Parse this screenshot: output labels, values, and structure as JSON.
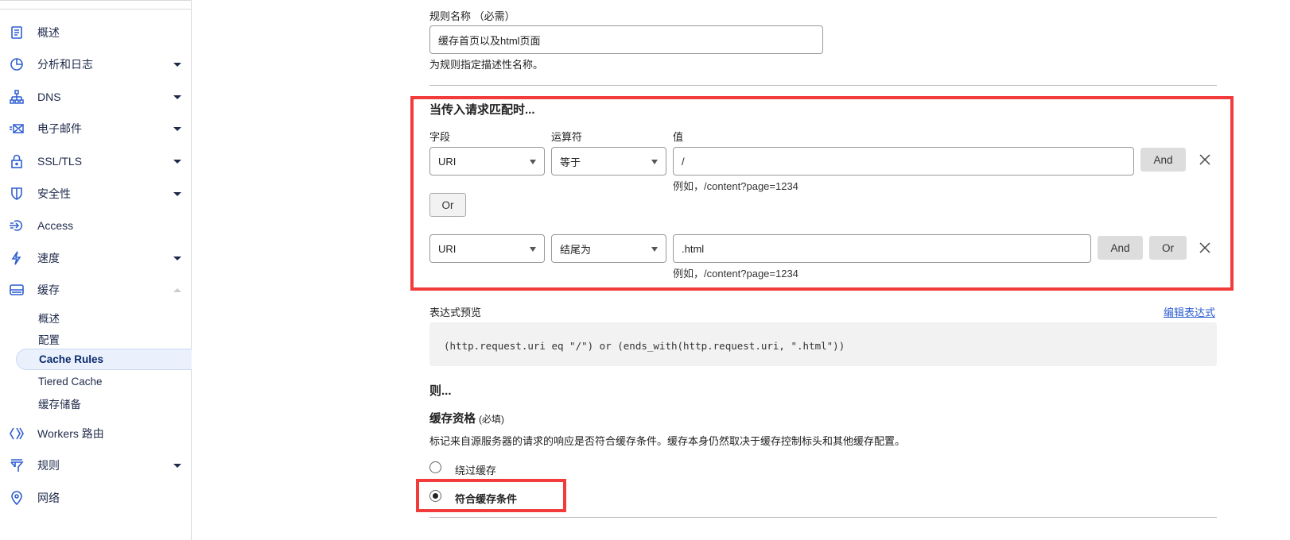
{
  "sidebar": {
    "items": [
      {
        "label": "概述",
        "icon": "clipboard-icon",
        "caret": false
      },
      {
        "label": "分析和日志",
        "icon": "pie-chart-icon",
        "caret": true
      },
      {
        "label": "DNS",
        "icon": "network-tree-icon",
        "caret": true
      },
      {
        "label": "电子邮件",
        "icon": "email-icon",
        "caret": true
      },
      {
        "label": "SSL/TLS",
        "icon": "lock-icon",
        "caret": true
      },
      {
        "label": "安全性",
        "icon": "shield-icon",
        "caret": true
      },
      {
        "label": "Access",
        "icon": "access-icon",
        "caret": false
      },
      {
        "label": "速度",
        "icon": "lightning-icon",
        "caret": true
      },
      {
        "label": "缓存",
        "icon": "cache-server-icon",
        "caret": true,
        "expanded": true
      }
    ],
    "cache_subitems": [
      "概述",
      "配置",
      "Cache Rules",
      "Tiered Cache",
      "缓存储备"
    ],
    "active_subitem": "Cache Rules",
    "items_after": [
      {
        "label": "Workers 路由",
        "icon": "workers-icon",
        "caret": false
      },
      {
        "label": "规则",
        "icon": "filter-icon",
        "caret": true
      },
      {
        "label": "网络",
        "icon": "location-pin-icon",
        "caret": false
      }
    ]
  },
  "form": {
    "rule_name_label": "规则名称 （必需）",
    "rule_name_value": "缓存首页以及html页面",
    "rule_name_help": "为规则指定描述性名称。",
    "match_heading": "当传入请求匹配时...",
    "col_field": "字段",
    "col_operator": "运算符",
    "col_value": "值",
    "conditions": [
      {
        "field": "URI",
        "operator": "等于",
        "value": "/",
        "hint": "例如，/content?page=1234"
      },
      {
        "field": "URI",
        "operator": "结尾为",
        "value": ".html",
        "hint": "例如，/content?page=1234"
      }
    ],
    "and_label": "And",
    "or_label": "Or",
    "expr_preview_label": "表达式预览",
    "edit_expression_link": "编辑表达式",
    "expression": "(http.request.uri eq \"/\") or (ends_with(http.request.uri, \".html\"))",
    "then_heading": "则...",
    "cache_eligibility_title": "缓存资格",
    "cache_eligibility_required": "(必填)",
    "cache_eligibility_desc": "标记来自源服务器的请求的响应是否符合缓存条件。缓存本身仍然取决于缓存控制标头和其他缓存配置。",
    "options": [
      "绕过缓存",
      "符合缓存条件"
    ],
    "selected_option": "符合缓存条件"
  },
  "colors": {
    "highlight": "#f23b3b",
    "link": "#2f5fd0",
    "icon": "#2f5fd0"
  }
}
